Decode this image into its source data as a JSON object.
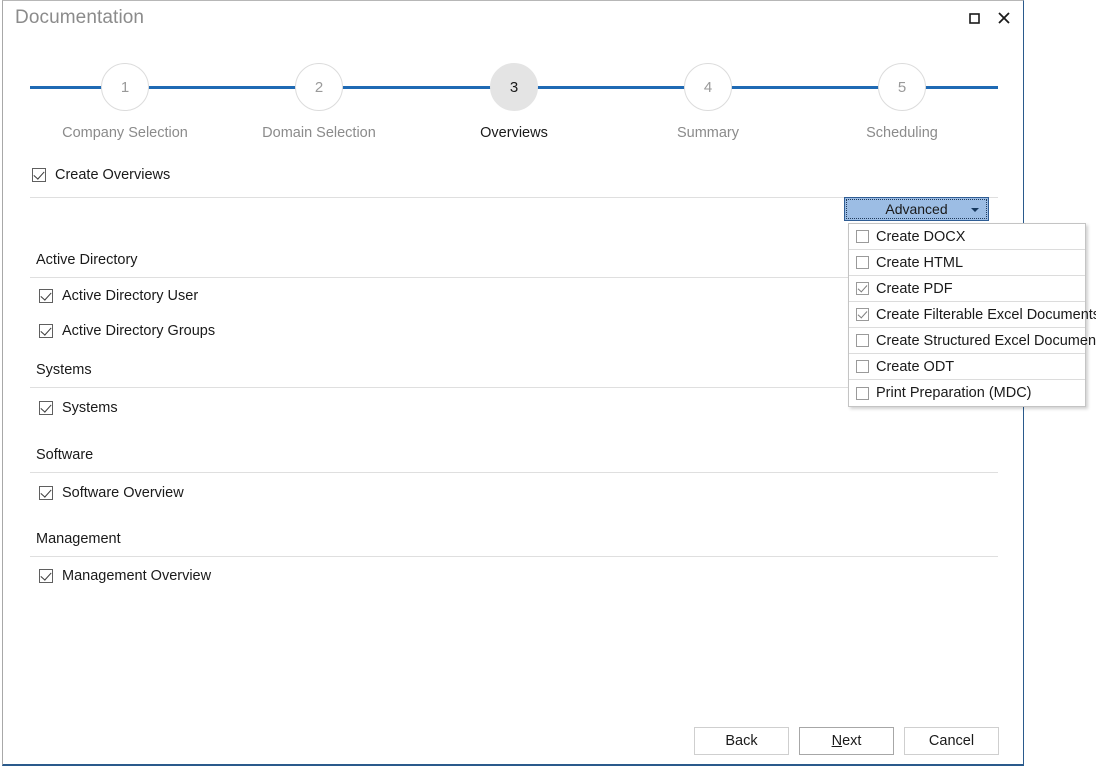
{
  "window": {
    "title": "Documentation",
    "controls": [
      {
        "name": "maximize-button",
        "icon": "maximize-icon",
        "label": "Maximize"
      },
      {
        "name": "close-button",
        "icon": "close-icon",
        "label": "Close"
      }
    ]
  },
  "stepper": {
    "current_step": 3,
    "steps": [
      {
        "number": "1",
        "label": "Company Selection",
        "active": false
      },
      {
        "number": "2",
        "label": "Domain Selection",
        "active": false
      },
      {
        "number": "3",
        "label": "Overviews",
        "active": true
      },
      {
        "number": "4",
        "label": "Summary",
        "active": false
      },
      {
        "number": "5",
        "label": "Scheduling",
        "active": false
      }
    ]
  },
  "main": {
    "create_overviews": {
      "label": "Create Overviews",
      "checked": true
    },
    "sections": [
      {
        "title": "Active Directory",
        "items": [
          {
            "label": "Active Directory User",
            "checked": true
          },
          {
            "label": "Active Directory Groups",
            "checked": true
          }
        ]
      },
      {
        "title": "Systems",
        "items": [
          {
            "label": "Systems",
            "checked": true
          }
        ]
      },
      {
        "title": "Software",
        "items": [
          {
            "label": "Software Overview",
            "checked": true
          }
        ]
      },
      {
        "title": "Management",
        "items": [
          {
            "label": "Management Overview",
            "checked": true
          }
        ]
      }
    ]
  },
  "advanced": {
    "button_label": "Advanced",
    "open": true,
    "menu_items": [
      {
        "label": "Create DOCX",
        "checked": false
      },
      {
        "label": "Create HTML",
        "checked": false
      },
      {
        "label": "Create PDF",
        "checked": true
      },
      {
        "label": "Create Filterable Excel Documents",
        "checked": true
      },
      {
        "label": "Create Structured Excel Documents",
        "checked": false
      },
      {
        "label": "Create ODT",
        "checked": false
      },
      {
        "label": "Print Preparation (MDC)",
        "checked": false
      }
    ]
  },
  "footer": {
    "back_label": "Back",
    "next_label_prefix": "",
    "next_mnemonic": "N",
    "next_label_rest": "ext",
    "cancel_label": "Cancel"
  },
  "colors": {
    "accent_blue": "#1f6ab4",
    "window_border_blue": "#2a5a8c",
    "advanced_fill": "#9cbde4",
    "separator": "#dfdfdf",
    "muted_text": "#8b8b8b"
  }
}
